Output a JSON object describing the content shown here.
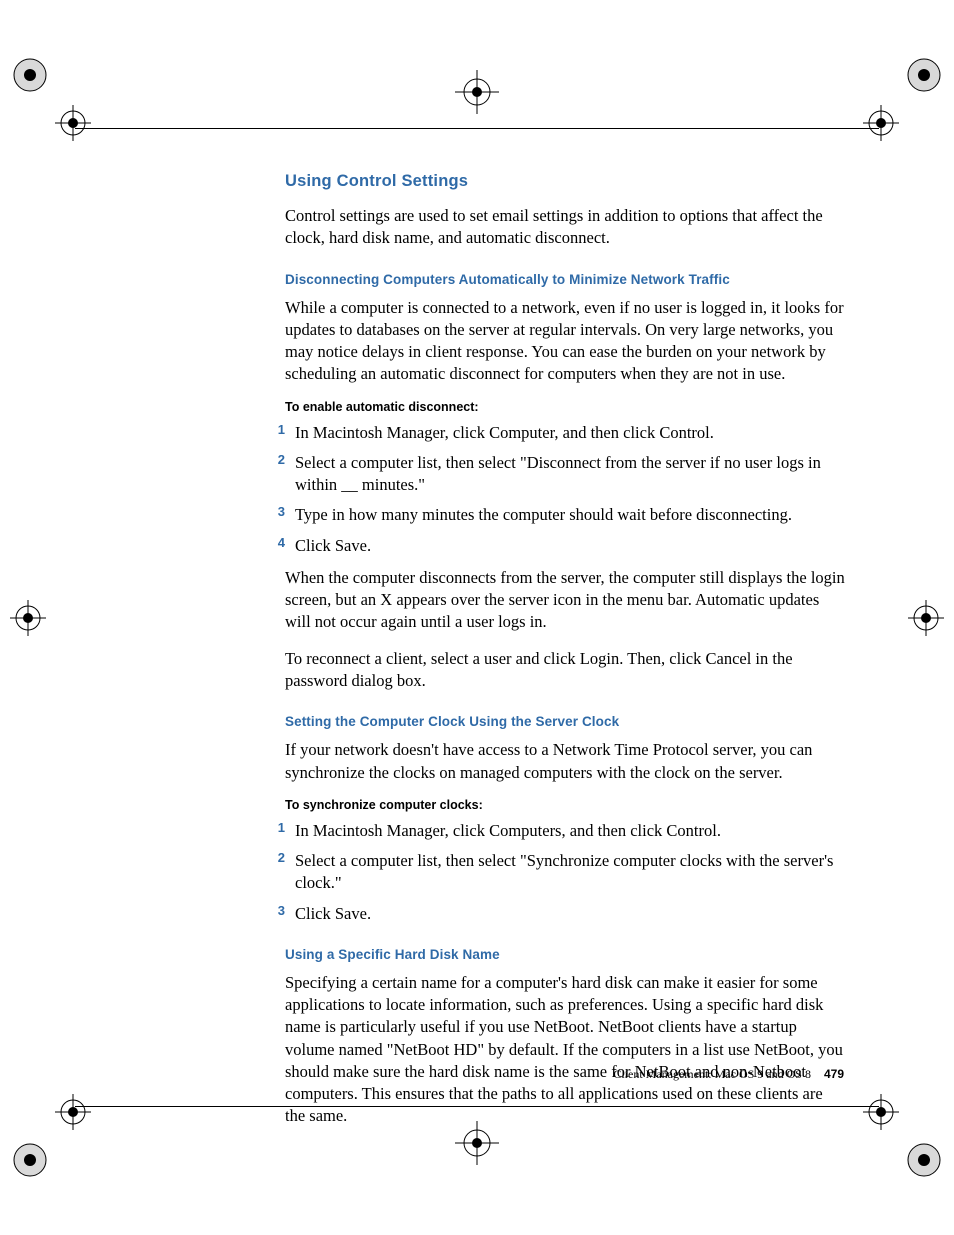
{
  "headings": {
    "h2": "Using Control Settings",
    "h3_a": "Disconnecting Computers Automatically to Minimize Network Traffic",
    "h3_b": "Setting the Computer Clock Using the Server Clock",
    "h3_c": "Using a Specific Hard Disk Name"
  },
  "paragraphs": {
    "intro": "Control settings are used to set email settings in addition to options that affect the clock, hard disk name, and automatic disconnect.",
    "disc_intro": "While a computer is connected to a network, even if no user is logged in, it looks for updates to databases on the server at regular intervals. On very large networks, you may notice delays in client response. You can ease the burden on your network by scheduling an automatic disconnect for computers when they are not in use.",
    "disc_after": "When the computer disconnects from the server, the computer still displays the login screen, but an X appears over the server icon in the menu bar. Automatic updates will not occur again until a user logs in.",
    "disc_reconnect": "To reconnect a client, select a user and click Login. Then, click Cancel in the password dialog box.",
    "clock_intro": "If your network doesn't have access to a Network Time Protocol server, you can synchronize the clocks on managed computers with the clock on the server.",
    "hdd_intro": "Specifying a certain name for a computer's hard disk can make it easier for some applications to locate information, such as preferences. Using a specific hard disk name is particularly useful if you use NetBoot. NetBoot clients have a startup volume named \"NetBoot HD\" by default. If the computers in a list use NetBoot, you should make sure the hard disk name is the same for NetBoot and non-Netboot computers. This ensures that the paths to all applications used on these clients are the same."
  },
  "step_headings": {
    "enable_disc": "To enable automatic disconnect:",
    "sync_clocks": "To synchronize computer clocks:"
  },
  "steps_disc": [
    "In Macintosh Manager, click Computer, and then click Control.",
    "Select a computer list, then select \"Disconnect from the server if no user logs in within __ minutes.\"",
    "Type in how many minutes the computer should wait before disconnecting.",
    "Click Save."
  ],
  "steps_clock": [
    "In Macintosh Manager, click Computers, and then click Control.",
    "Select a computer list, then select \"Synchronize computer clocks with the server's clock.\"",
    "Click Save."
  ],
  "nums": {
    "n1": "1",
    "n2": "2",
    "n3": "3",
    "n4": "4"
  },
  "footer": {
    "text": "Client Management: Mac OS 9 and OS 8",
    "page": "479"
  }
}
